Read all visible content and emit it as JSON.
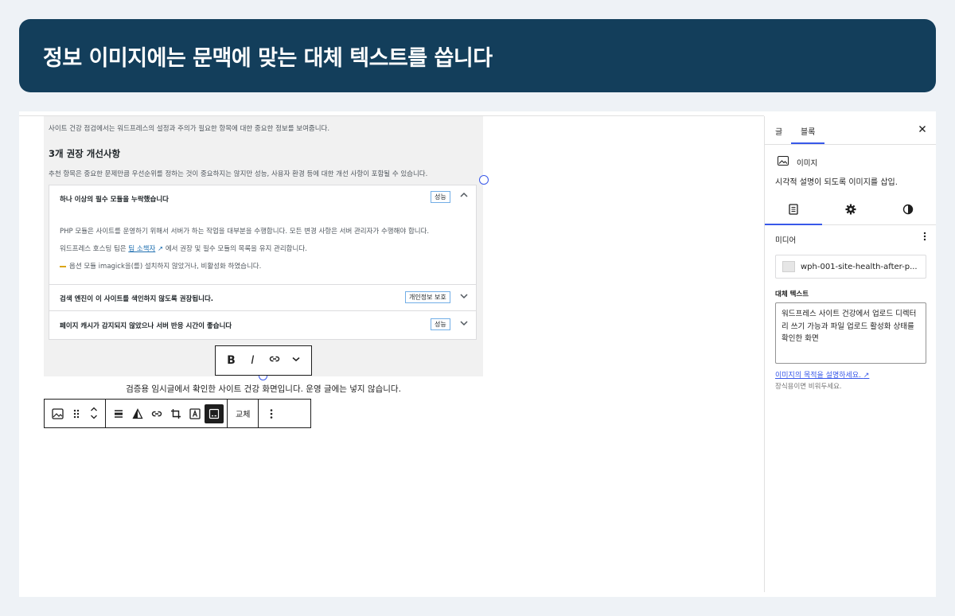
{
  "banner": {
    "title": "정보 이미지에는 문맥에 맞는 대체 텍스트를 씁니다"
  },
  "screenshot": {
    "intro": "사이트 건강 점검에서는 워드프레스의 설정과 주의가 필요한 항목에 대한 중요한 정보를 보여줍니다.",
    "heading": "3개 권장 개선사항",
    "desc": "추천 항목은 중요한 문제만큼 우선순위를 정하는 것이 중요하지는 않지만 성능, 사용자 환경 등에 대한 개선 사항이 포함될 수 있습니다.",
    "items": [
      {
        "title": "하나 이상의 필수 모듈을 누락했습니다",
        "badge": "성능"
      },
      {
        "title": "검색 엔진이 이 사이트를 색인하지 않도록 권장됩니다.",
        "badge": "개인정보 보호"
      },
      {
        "title": "페이지 캐시가 감지되지 않았으나 서버 반응 시간이 좋습니다",
        "badge": "성능"
      }
    ],
    "body": {
      "line1": "PHP 모듈은 사이트를 운영하기 위해서 서버가 하는 작업을 대부분을 수행합니다. 모든 변경 사항은 서버 관리자가 수행해야 합니다.",
      "line2_prefix": "워드프레스 호스팅 팀은",
      "line2_link": "팀 소책자",
      "line2_suffix": "에서 권장 및 필수 모듈의 목록을 유지 관리합니다.",
      "line3": "옵션 모듈 imagick을(를) 설치하지 않았거나, 비활성화 하였습니다."
    }
  },
  "format_toolbar": {
    "bold": "B",
    "italic": "I"
  },
  "caption": "검증용 임시글에서 확인한 사이트 건강 화면입니다. 운영 글에는 넣지 않습니다.",
  "block_toolbar": {
    "replace_label": "교체"
  },
  "sidebar": {
    "tabs": [
      "글",
      "블록"
    ],
    "block_name": "이미지",
    "block_desc": "시각적 설명이 되도록 이미지를 삽입.",
    "media_label": "미디어",
    "file_name": "wph-001-site-health-after-p...",
    "alt_label": "대체 텍스트",
    "alt_value": "워드프레스 사이트 건강에서 업로드 디렉터리 쓰기 가능과 파일 업로드 활성화 상태를 확인한 화면",
    "help_link": "이미지의 목적을 설명하세요.",
    "help_note": "장식용이면 비워두세요."
  },
  "icons": [
    "image-icon",
    "drag-handle-icon",
    "chevron-up-icon",
    "chevron-down-icon",
    "align-icon",
    "duotone-icon",
    "link-icon",
    "crop-icon",
    "text-overlay-icon",
    "caption-icon",
    "more-vertical-icon",
    "close-icon",
    "settings-icon",
    "styles-icon",
    "external-link-icon"
  ]
}
